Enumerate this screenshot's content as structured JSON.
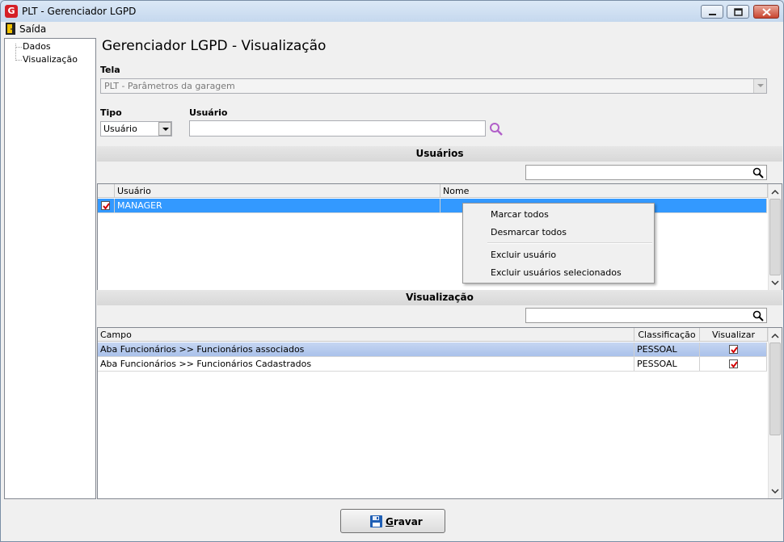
{
  "window": {
    "title": "PLT - Gerenciador LGPD",
    "app_icon": "G"
  },
  "menu": {
    "exit_label": "Saída"
  },
  "tree": {
    "items": [
      "Dados",
      "Visualização"
    ]
  },
  "main": {
    "title": "Gerenciador LGPD - Visualização",
    "tela_label": "Tela",
    "tela_value": "PLT - Parâmetros da garagem",
    "tipo_label": "Tipo",
    "tipo_value": "Usuário",
    "usuario_label": "Usuário",
    "usuario_value": ""
  },
  "users_section": {
    "title": "Usuários",
    "filter_value": "",
    "columns": [
      "Usuário",
      "Nome"
    ],
    "rows": [
      {
        "checked": true,
        "usuario": "MANAGER",
        "nome": ""
      }
    ]
  },
  "context_menu": {
    "items": [
      "Marcar todos",
      "Desmarcar todos",
      "Excluir usuário",
      "Excluir usuários selecionados"
    ]
  },
  "view_section": {
    "title": "Visualização",
    "filter_value": "",
    "columns": [
      "Campo",
      "Classificação",
      "Visualizar"
    ],
    "rows": [
      {
        "campo": "Aba Funcionários >> Funcionários associados",
        "classificacao": "PESSOAL",
        "visualizar": true
      },
      {
        "campo": "Aba Funcionários >> Funcionários Cadastrados",
        "classificacao": "PESSOAL",
        "visualizar": true
      }
    ]
  },
  "footer": {
    "save_label": "Gravar",
    "save_accel": "G",
    "save_rest": "ravar"
  },
  "colors": {
    "selection": "#3399ff",
    "close_button": "#c9452f",
    "app_icon": "#d51f26"
  }
}
